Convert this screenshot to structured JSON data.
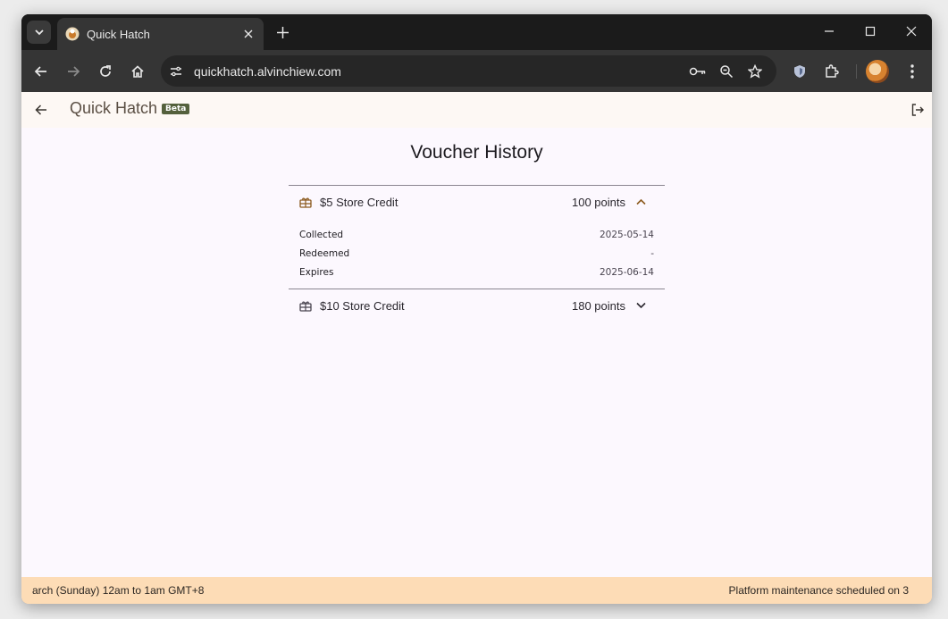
{
  "browser": {
    "tab_title": "Quick Hatch",
    "url": "quickhatch.alvinchiew.com"
  },
  "app": {
    "title": "Quick Hatch",
    "badge": "Beta",
    "heading": "Voucher History"
  },
  "vouchers": [
    {
      "name": "$5 Store Credit",
      "points": "100 points",
      "expanded": true,
      "details": [
        {
          "label": "Collected",
          "value": "2025-05-14"
        },
        {
          "label": "Redeemed",
          "value": "-"
        },
        {
          "label": "Expires",
          "value": "2025-06-14"
        }
      ]
    },
    {
      "name": "$10 Store Credit",
      "points": "180 points",
      "expanded": false
    }
  ],
  "footer": {
    "left_text": "arch (Sunday) 12am to 1am GMT+8",
    "right_text": "Platform maintenance scheduled on 3"
  },
  "colors": {
    "accent": "#8b5a1e",
    "badge_bg": "#54603c",
    "footer_bg": "#fddcb6"
  }
}
